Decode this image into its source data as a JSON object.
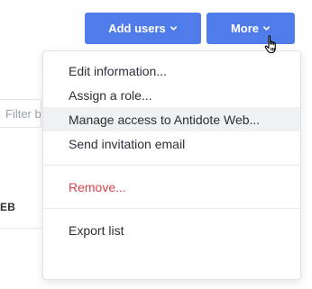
{
  "toolbar": {
    "add_users_label": "Add users",
    "more_label": "More"
  },
  "filter": {
    "placeholder": "Filter b"
  },
  "table": {
    "column_header": "EB"
  },
  "more_menu": {
    "groups": [
      [
        {
          "label": "Edit information..."
        },
        {
          "label": "Assign a role..."
        },
        {
          "label": "Manage access to Antidote Web...",
          "hovered": true
        },
        {
          "label": "Send invitation email"
        }
      ],
      [
        {
          "label": "Remove...",
          "danger": true
        }
      ],
      [
        {
          "label": "Export list"
        }
      ]
    ]
  },
  "colors": {
    "accent": "#4f7ce9",
    "danger": "#d9434a",
    "hover_bg": "#f0f1f3"
  },
  "icons": {
    "button_caret": "chevron-down-icon",
    "cursor": "hand-pointer-icon"
  }
}
